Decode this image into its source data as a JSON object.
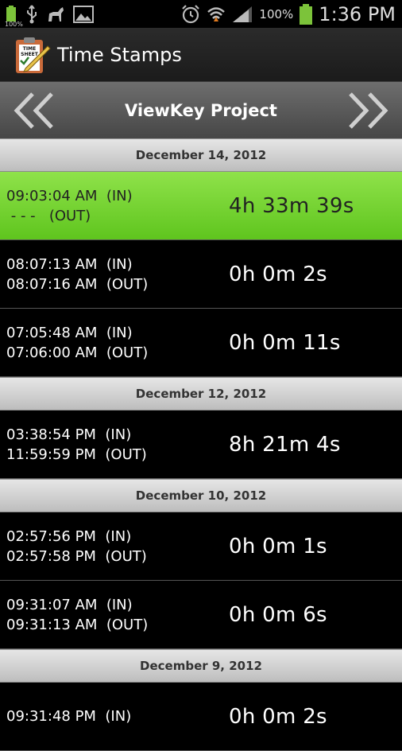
{
  "status_bar": {
    "battery_small_pct": "100%",
    "battery_pct": "100%",
    "time": "1:36 PM"
  },
  "app": {
    "title": "Time Stamps",
    "icon_text": "TIME SHEET"
  },
  "project": {
    "name": "ViewKey Project"
  },
  "groups": [
    {
      "date": "December 14, 2012",
      "entries": [
        {
          "in": "09:03:04 AM  (IN)",
          "out": " - - -   (OUT)",
          "duration": "4h 33m 39s",
          "active": true
        },
        {
          "in": "08:07:13 AM  (IN)",
          "out": "08:07:16 AM  (OUT)",
          "duration": "0h 0m 2s"
        },
        {
          "in": "07:05:48 AM  (IN)",
          "out": "07:06:00 AM  (OUT)",
          "duration": "0h 0m 11s"
        }
      ]
    },
    {
      "date": "December 12, 2012",
      "entries": [
        {
          "in": "03:38:54 PM  (IN)",
          "out": "11:59:59 PM  (OUT)",
          "duration": "8h 21m 4s"
        }
      ]
    },
    {
      "date": "December 10, 2012",
      "entries": [
        {
          "in": "02:57:56 PM  (IN)",
          "out": "02:57:58 PM  (OUT)",
          "duration": "0h 0m 1s"
        },
        {
          "in": "09:31:07 AM  (IN)",
          "out": "09:31:13 AM  (OUT)",
          "duration": "0h 0m 6s"
        }
      ]
    },
    {
      "date": "December 9, 2012",
      "entries": [
        {
          "in": "09:31:48 PM  (IN)",
          "out": "",
          "duration": "0h 0m 2s"
        }
      ]
    }
  ]
}
